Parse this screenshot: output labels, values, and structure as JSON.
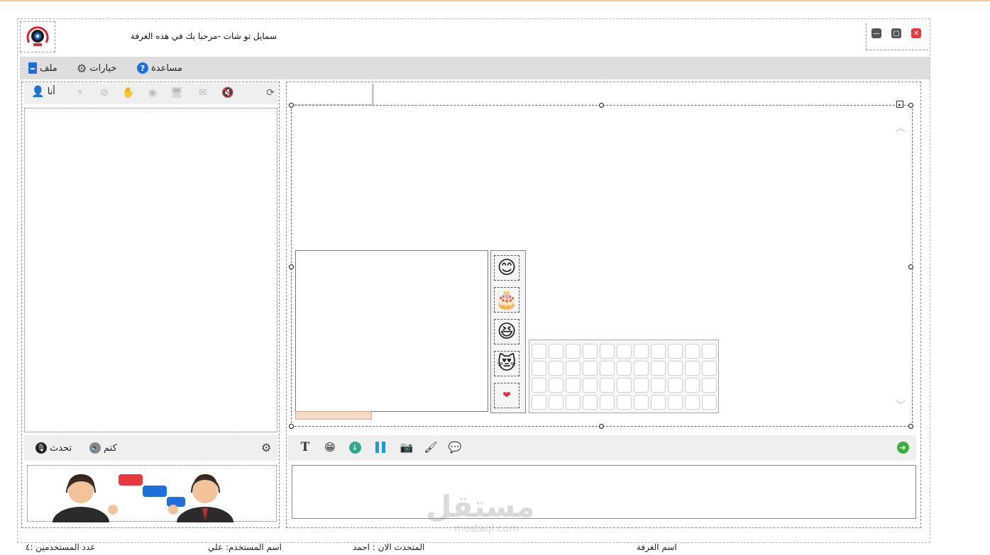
{
  "window": {
    "title": "سمايل تو شات -مرحبا بك في هذه الغرفة",
    "controls": {
      "minimize": "—",
      "restore": "▢",
      "close": "✕"
    }
  },
  "menu": {
    "file": "ملف",
    "options": "خيارات",
    "help": "مساعدة"
  },
  "left_toolbar": {
    "me_label": "أنا"
  },
  "voice_bar": {
    "talk_label": "تحدث",
    "mute_label": "كتم"
  },
  "emoticons": [
    "😊",
    "🎂",
    "😆",
    "😻",
    "❤"
  ],
  "grid": {
    "rows": 4,
    "cols": 11
  },
  "status": {
    "user_count": "عدد المستخدمين :٤",
    "username": "اسم المستخدم: علي",
    "current_speaker": "المتحدث الان : احمد",
    "room_name": "اسم الغرفة"
  },
  "watermark": {
    "brand": "مستقل",
    "site": "mostaql.com"
  },
  "colors": {
    "accent_blue": "#1e6fd9",
    "close_red": "#e8383d",
    "menu_bg": "#dedede"
  }
}
